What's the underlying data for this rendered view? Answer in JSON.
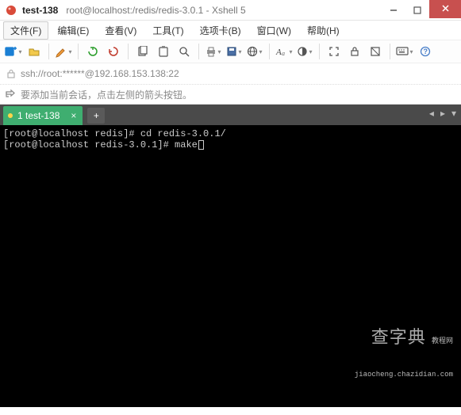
{
  "window": {
    "title_main": "test-138",
    "title_sub": "root@localhost:/redis/redis-3.0.1 - Xshell 5"
  },
  "menu": {
    "file": "文件(F)",
    "edit": "编辑(E)",
    "view": "查看(V)",
    "tools": "工具(T)",
    "tabs": "选项卡(B)",
    "window": "窗口(W)",
    "help": "帮助(H)"
  },
  "address": {
    "text": "ssh://root:******@192.168.153.138:22"
  },
  "hint": {
    "text": "要添加当前会话，点击左侧的箭头按钮。"
  },
  "tab": {
    "label": "1 test-138",
    "close": "×",
    "new": "+"
  },
  "terminal": {
    "line1_prompt": "[root@localhost redis]# ",
    "line1_cmd": "cd redis-3.0.1/",
    "line2_prompt": "[root@localhost redis-3.0.1]# ",
    "line2_cmd": "make"
  },
  "watermark": {
    "big": "查字典",
    "small_label": "教程网",
    "url": "jiaocheng.chazidian.com"
  },
  "icons": {
    "new_session": "new-session-icon",
    "open": "open-icon",
    "disconnect": "disconnect-icon",
    "reconnect": "reconnect-icon",
    "properties": "properties-icon",
    "copy": "copy-icon",
    "paste": "paste-icon",
    "find": "find-icon",
    "print": "print-icon",
    "globe": "globe-icon",
    "font": "font-icon",
    "color": "color-icon",
    "fullscreen": "fullscreen-icon",
    "lockscroll": "lockscroll-icon",
    "transparent": "transparent-icon",
    "keymap": "keymap-icon",
    "help": "help-icon"
  }
}
